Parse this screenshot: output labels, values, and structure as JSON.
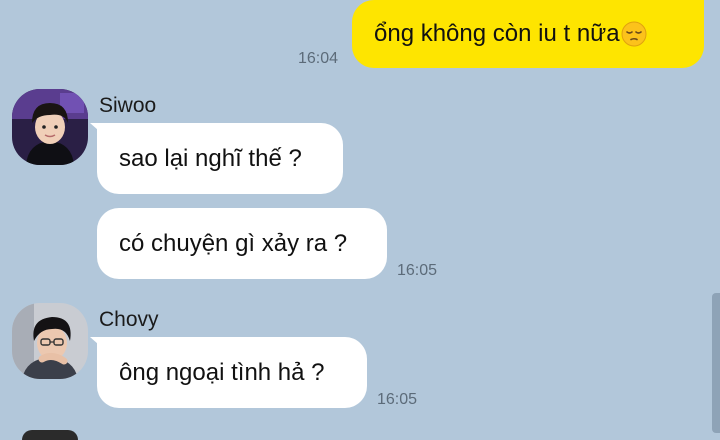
{
  "messages": {
    "outgoing": {
      "text": "ổng không còn iu t nữa",
      "emoji": "pensive-face-emoji",
      "time": "16:04"
    },
    "siwoo": {
      "name": "Siwoo",
      "msg1": "sao lại nghĩ thế ?",
      "msg2": "có chuyện gì xảy ra ?",
      "time": "16:05"
    },
    "chovy": {
      "name": "Chovy",
      "msg1": "ông ngoại tình hả ?",
      "time": "16:05"
    }
  },
  "colors": {
    "background": "#b2c7da",
    "outgoing_bubble": "#fee500",
    "incoming_bubble": "#ffffff"
  }
}
